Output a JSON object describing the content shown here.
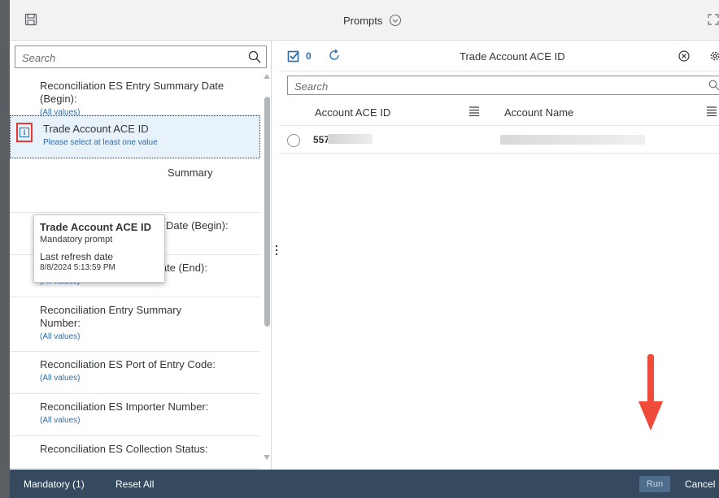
{
  "header": {
    "title": "Prompts",
    "save_icon": "save-icon",
    "expand_icon": "expand-icon",
    "title_icon": "chevron-down-circle-icon"
  },
  "left": {
    "search_placeholder": "Search",
    "items": [
      {
        "label": "Reconciliation ES Entry Summary Date (Begin):",
        "value": "(All values)"
      },
      {
        "label": "Trade Account ACE ID",
        "value": "Please select at least one value",
        "selected": true
      },
      {
        "label": "Summary",
        "value": ""
      },
      {
        "label": "Date (Begin):",
        "value": "(All values)"
      },
      {
        "label": "Reconciliation ES Entry Date (End):",
        "value": "(All values)"
      },
      {
        "label": "Reconciliation Entry Summary Number:",
        "value": "(All values)"
      },
      {
        "label": "Reconciliation ES Port of Entry Code:",
        "value": "(All values)"
      },
      {
        "label": "Reconciliation ES Importer Number:",
        "value": "(All values)"
      },
      {
        "label": "Reconciliation ES Collection Status:",
        "value": ""
      }
    ],
    "tooltip": {
      "title": "Trade Account ACE ID",
      "subtitle": "Mandatory prompt",
      "refresh_label": "Last refresh date",
      "refresh_date": "8/8/2024 5:13:59 PM"
    }
  },
  "right": {
    "selected_count": "0",
    "title": "Trade Account ACE ID",
    "search_placeholder": "Search",
    "columns": [
      "Account ACE ID",
      "Account Name"
    ],
    "rows": [
      {
        "id": "557",
        "name": ""
      }
    ]
  },
  "footer": {
    "mandatory": "Mandatory (1)",
    "reset": "Reset All",
    "run": "Run",
    "cancel": "Cancel"
  },
  "colors": {
    "accent": "#2a6cad",
    "footer_bg": "#354a5f",
    "highlight_red": "#e53935"
  }
}
